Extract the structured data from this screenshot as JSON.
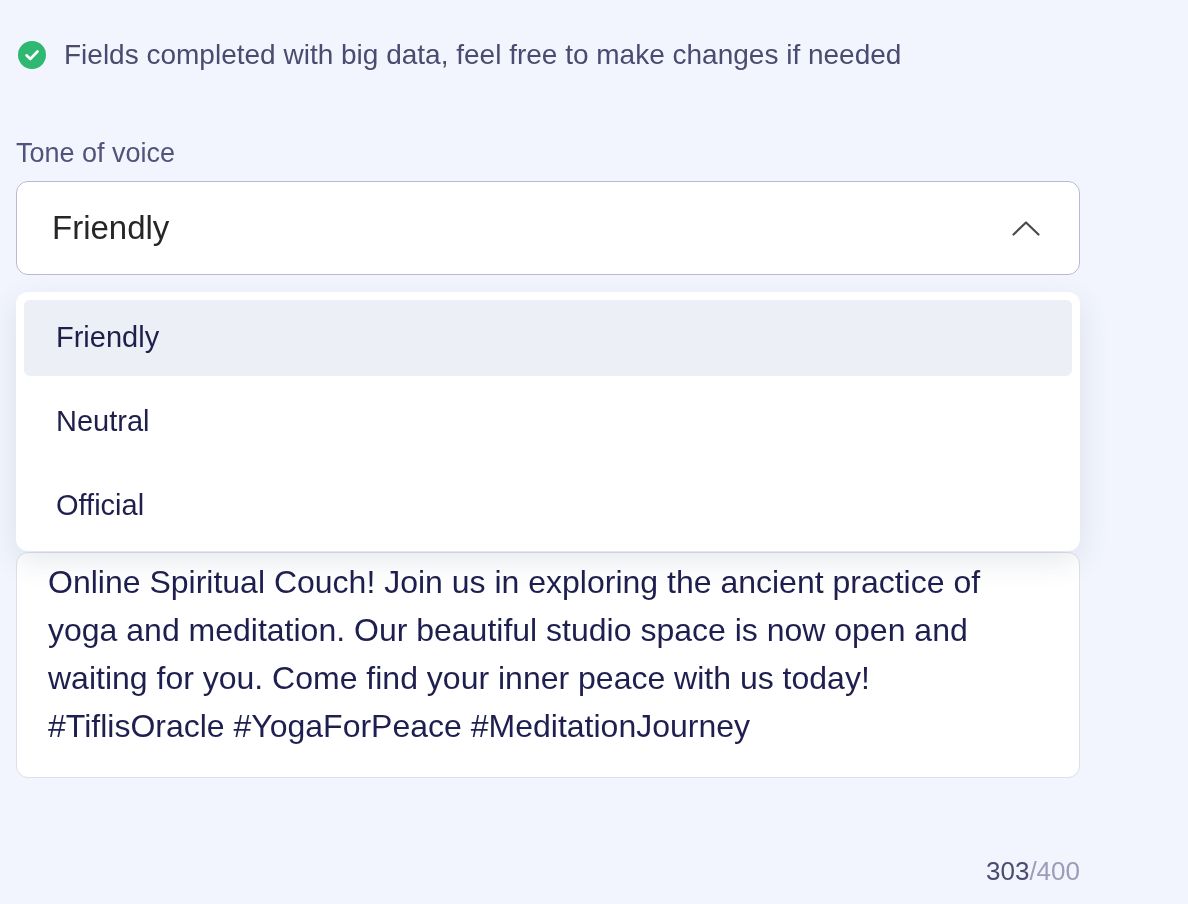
{
  "notice": {
    "text": "Fields completed with big data, feel free to make changes if needed"
  },
  "tone_of_voice": {
    "label": "Tone of voice",
    "value": "Friendly",
    "expanded": true,
    "options": [
      {
        "label": "Friendly",
        "selected": true
      },
      {
        "label": "Neutral",
        "selected": false
      },
      {
        "label": "Official",
        "selected": false
      }
    ]
  },
  "message": {
    "value": "Online Spiritual Couch! Join us in exploring the ancient practice of yoga and meditation. Our beautiful studio space is now open and waiting for you. Come find your inner peace with us today! #TiflisOracle #YogaForPeace #MeditationJourney"
  },
  "counter": {
    "current": "303",
    "limit": "/400"
  }
}
